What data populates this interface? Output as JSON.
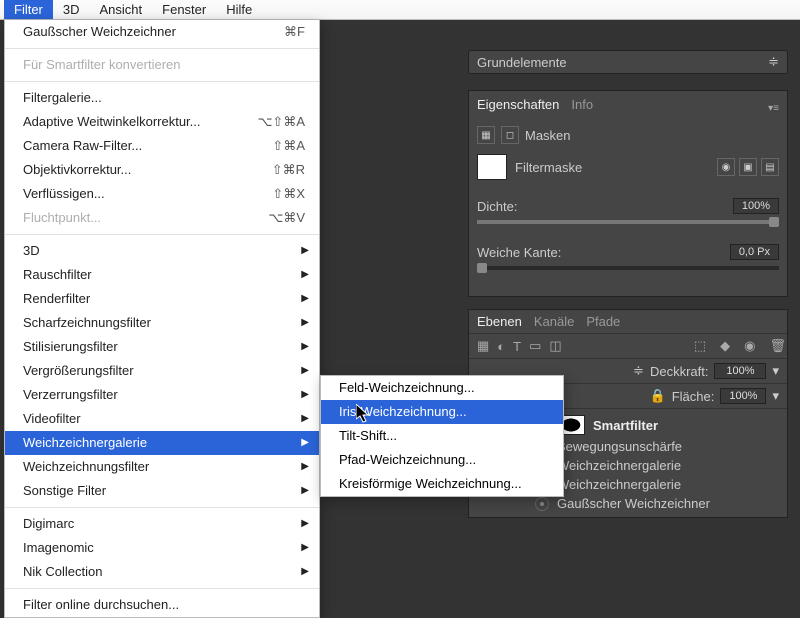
{
  "menubar": {
    "items": [
      "Filter",
      "3D",
      "Ansicht",
      "Fenster",
      "Hilfe"
    ],
    "selected": 0
  },
  "filter_menu": {
    "last": {
      "label": "Gaußscher Weichzeichner",
      "shortcut": "⌘F"
    },
    "convert_smart": "Für Smartfilter konvertieren",
    "items2": [
      {
        "label": "Filtergalerie..."
      },
      {
        "label": "Adaptive Weitwinkelkorrektur...",
        "shortcut": "⌥⇧⌘A"
      },
      {
        "label": "Camera Raw-Filter...",
        "shortcut": "⇧⌘A"
      },
      {
        "label": "Objektivkorrektur...",
        "shortcut": "⇧⌘R"
      },
      {
        "label": "Verflüssigen...",
        "shortcut": "⇧⌘X"
      },
      {
        "label": "Fluchtpunkt...",
        "shortcut": "⌥⌘V",
        "disabled": true
      }
    ],
    "submenus": [
      "3D",
      "Rauschfilter",
      "Renderfilter",
      "Scharfzeichnungsfilter",
      "Stilisierungsfilter",
      "Vergrößerungsfilter",
      "Verzerrungsfilter",
      "Videofilter",
      "Weichzeichnergalerie",
      "Weichzeichnungsfilter",
      "Sonstige Filter"
    ],
    "selected_submenu": 8,
    "plugins": [
      "Digimarc",
      "Imagenomic",
      "Nik Collection"
    ],
    "online": "Filter online durchsuchen..."
  },
  "blur_gallery": {
    "items": [
      "Feld-Weichzeichnung...",
      "Iris-Weichzeichnung...",
      "Tilt-Shift...",
      "Pfad-Weichzeichnung...",
      "Kreisförmige Weichzeichnung..."
    ],
    "selected": 1
  },
  "preset": {
    "label": "Grundelemente"
  },
  "properties": {
    "tabs": [
      "Eigenschaften",
      "Info"
    ],
    "active_tab": 0,
    "masken": "Masken",
    "filtermaske": "Filtermaske",
    "dichte": {
      "label": "Dichte:",
      "value": "100%"
    },
    "weiche": {
      "label": "Weiche Kante:",
      "value": "0,0 Px"
    }
  },
  "layers": {
    "tabs": [
      "Ebenen",
      "Kanäle",
      "Pfade"
    ],
    "active_tab": 0,
    "opacity": {
      "label": "Deckkraft:",
      "value": "100%"
    },
    "fill": {
      "label": "Fläche:",
      "value": "100%"
    },
    "smart_header": "Smartfilter",
    "filters": [
      "Bewegungsunschärfe",
      "Weichzeichnergalerie",
      "Weichzeichnergalerie",
      "Gaußscher Weichzeichner"
    ]
  }
}
